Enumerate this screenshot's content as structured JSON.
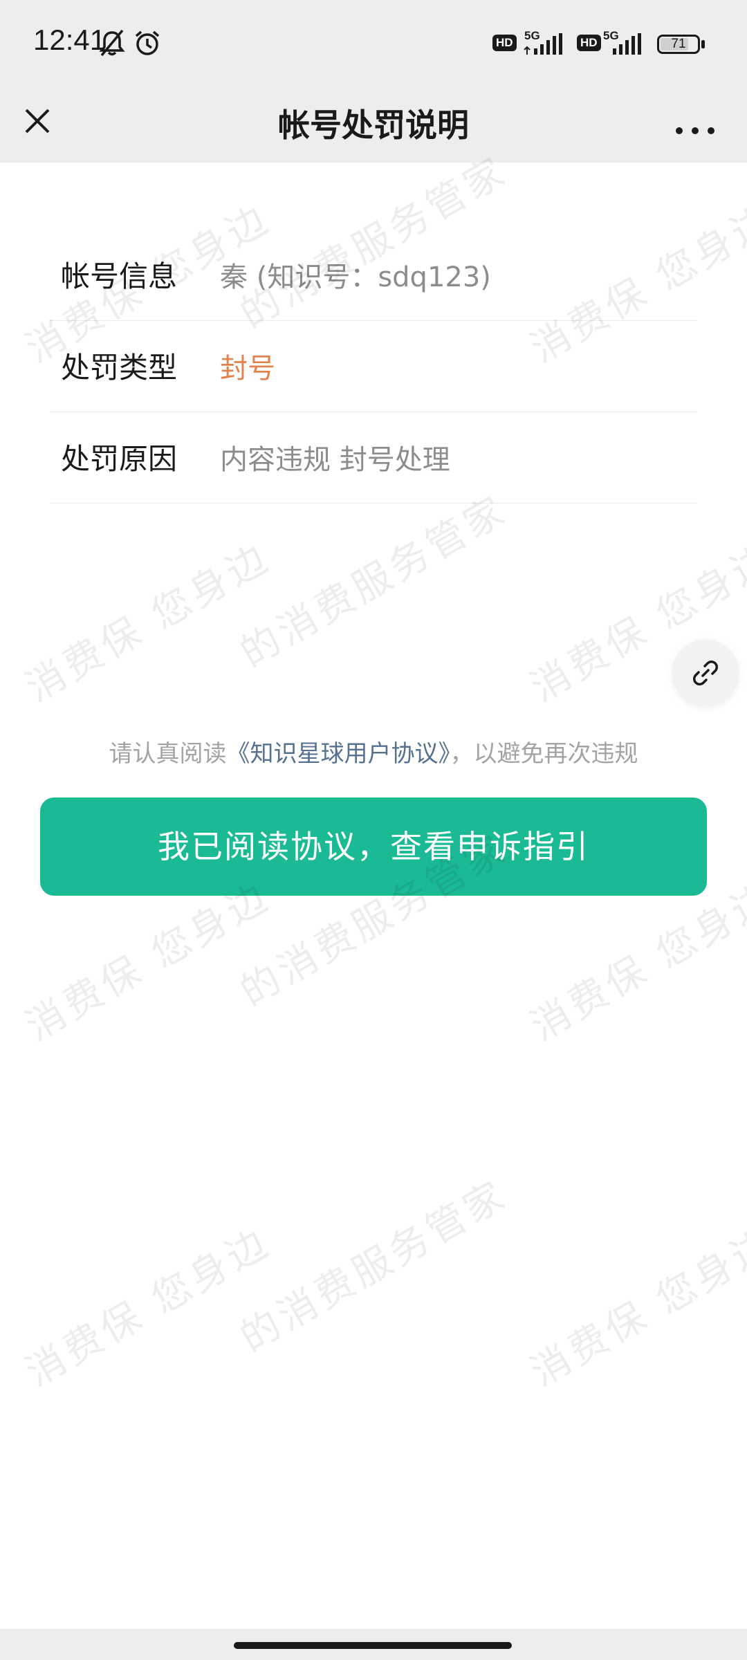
{
  "status_bar": {
    "time": "12:41",
    "icons": [
      "bell-off-icon",
      "alarm-icon",
      "hd-badge",
      "5g-signal-icon",
      "hd-badge",
      "5g-signal-icon",
      "battery-icon"
    ],
    "hd_label": "HD",
    "network_label": "5G",
    "battery_level": "71"
  },
  "nav": {
    "title": "帐号处罚说明",
    "close_icon": "close-icon",
    "more_icon": "more-icon"
  },
  "info": {
    "rows": [
      {
        "label": "帐号信息",
        "value": "秦 (知识号：sdq123)"
      },
      {
        "label": "处罚类型",
        "value": "封号"
      },
      {
        "label": "处罚原因",
        "value": "内容违规 封号处理"
      }
    ]
  },
  "agreement": {
    "prefix": "请认真阅读",
    "link_text": "《知识星球用户协议》",
    "suffix": "，以避免再次违规"
  },
  "action": {
    "button_label": "我已阅读协议，查看申诉指引"
  },
  "watermark": {
    "line_a": "消费保 您身边",
    "line_b": "的消费服务管家"
  },
  "colors": {
    "primary": "#1aba94",
    "accent": "#e2834d",
    "link": "#56718f",
    "chrome": "#ededed"
  }
}
